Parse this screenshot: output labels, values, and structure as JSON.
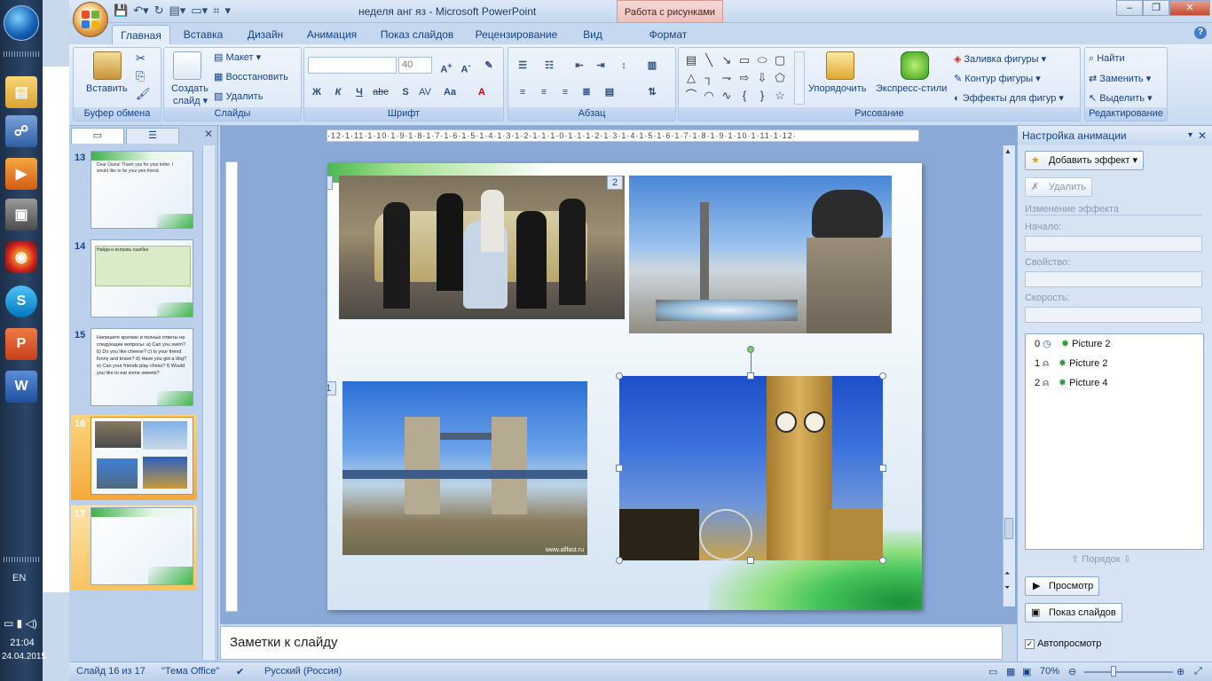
{
  "window": {
    "title": "неделя анг яз - Microsoft PowerPoint",
    "context_tab": "Работа с рисунками",
    "minimize": "–",
    "maximize": "❐",
    "close": "✕"
  },
  "taskbar": {
    "lang": "EN",
    "time": "21:04",
    "date": "24.04.2015"
  },
  "tabs": [
    "Главная",
    "Вставка",
    "Дизайн",
    "Анимация",
    "Показ слайдов",
    "Рецензирование",
    "Вид",
    "Формат"
  ],
  "ribbon": {
    "clipboard": {
      "label": "Буфер обмена",
      "paste": "Вставить"
    },
    "slides": {
      "label": "Слайды",
      "new_slide_1": "Создать",
      "new_slide_2": "слайд ▾",
      "layout": "Макет ▾",
      "reset": "Восстановить",
      "delete": "Удалить"
    },
    "font": {
      "label": "Шрифт",
      "size": "40"
    },
    "paragraph": {
      "label": "Абзац"
    },
    "drawing": {
      "label": "Рисование",
      "arrange": "Упорядочить",
      "quick_styles": "Экспресс-стили",
      "fill": "Заливка фигуры ▾",
      "outline": "Контур фигуры ▾",
      "effects": "Эффекты для фигур ▾"
    },
    "editing": {
      "label": "Редактирование",
      "find": "Найти",
      "replace": "Заменить ▾",
      "select": "Выделить ▾"
    }
  },
  "thumbnails": [
    {
      "num": "13",
      "text": "Dear Diana! Thank you for your letter. I would like to be your pen-friend."
    },
    {
      "num": "14",
      "text": "Найди и исправь ошибки"
    },
    {
      "num": "15",
      "text": "Напишите краткие и полные ответы на следующие вопросы: a) Can you swim? b) Do you like cheese? c) Is your friend funny and brave? d) Have you got a dog? e) Can your friends play chess? f) Would you like to eat some sweets?"
    },
    {
      "num": "16",
      "text": ""
    },
    {
      "num": "17",
      "text": ""
    }
  ],
  "ruler": "·12·1·11·1·10·1·9·1·8·1·7·1·6·1·5·1·4·1·3·1·2·1·1·1·0·1·1·1·2·1·3·1·4·1·5·1·6·1·7·1·8·1·9·1·10·1·11·1·12·",
  "slide": {
    "tags": [
      "0",
      "2",
      "1"
    ],
    "watermark": "www.allfast.ru"
  },
  "notes": {
    "placeholder": "Заметки к слайду"
  },
  "animation_pane": {
    "title": "Настройка анимации",
    "add_effect": "Добавить эффект ▾",
    "remove": "Удалить",
    "change_effect": "Изменение эффекта",
    "start_label": "Начало:",
    "property_label": "Свойство:",
    "speed_label": "Скорость:",
    "items": [
      {
        "index": "0",
        "name": "Picture 2"
      },
      {
        "index": "1",
        "name": "Picture 2"
      },
      {
        "index": "2",
        "name": "Picture 4"
      }
    ],
    "order": "Порядок",
    "preview": "Просмотр",
    "slideshow": "Показ слайдов",
    "autopreview": "Автопросмотр"
  },
  "status": {
    "slide": "Слайд 16 из 17",
    "theme": "\"Тема Office\"",
    "language": "Русский (Россия)",
    "zoom": "70%"
  }
}
